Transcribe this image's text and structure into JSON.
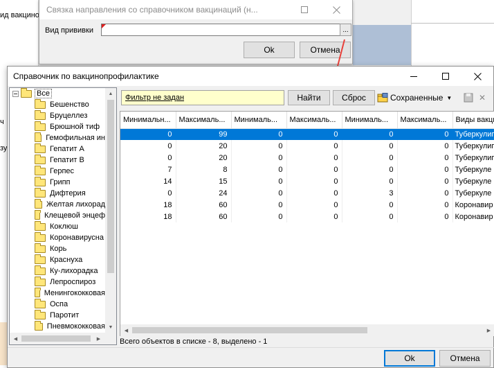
{
  "background": {
    "left_text_1": "ид вакцинопр",
    "left_text_2": "ч",
    "left_text_3": "зу"
  },
  "dialog_link": {
    "title": "Связка направления со справочником вакцинаций (н...",
    "field_label": "Вид прививки",
    "field_value": "",
    "ellipsis_label": "...",
    "ok_label": "Ok",
    "cancel_label": "Отмена"
  },
  "dialog_ref": {
    "title": "Справочник по вакцинопрофилактике",
    "tree": {
      "root": "Все",
      "items": [
        "Бешенство",
        "Бруцеллез",
        "Брюшной тиф",
        "Гемофильная ин",
        "Гепатит А",
        "Гепатит В",
        "Герпес",
        "Грипп",
        "Дифтерия",
        "Желтая лихорад",
        "Клещевой энцеф",
        "Коклюш",
        "Коронавирусна",
        "Корь",
        "Краснуха",
        "Ку-лихорадка",
        "Лепроспироз",
        "Менингококковая",
        "Оспа",
        "Паротит",
        "Пневмококковая"
      ]
    },
    "toolbar": {
      "filter_text": "Фильтр не задан",
      "find_label": "Найти",
      "reset_label": "Сброс",
      "saved_label": "Сохраненные"
    },
    "grid": {
      "columns": [
        "Минимальн...",
        "Максималь...",
        "Минималь...",
        "Максималь...",
        "Минималь...",
        "Максималь...",
        "Виды вакци"
      ],
      "rows": [
        [
          "0",
          "99",
          "0",
          "0",
          "0",
          "0",
          "Туберкулиг"
        ],
        [
          "0",
          "20",
          "0",
          "0",
          "0",
          "0",
          "Туберкулиг"
        ],
        [
          "0",
          "20",
          "0",
          "0",
          "0",
          "0",
          "Туберкулиг"
        ],
        [
          "7",
          "8",
          "0",
          "0",
          "0",
          "0",
          "Туберкуле"
        ],
        [
          "14",
          "15",
          "0",
          "0",
          "0",
          "0",
          "Туберкуле"
        ],
        [
          "0",
          "24",
          "0",
          "0",
          "3",
          "0",
          "Туберкуле"
        ],
        [
          "18",
          "60",
          "0",
          "0",
          "0",
          "0",
          "Коронавир"
        ],
        [
          "18",
          "60",
          "0",
          "0",
          "0",
          "0",
          "Коронавир"
        ]
      ],
      "selected_row": 0
    },
    "status": "Всего объектов в списке - 8, выделено - 1",
    "ok_label": "Ok",
    "cancel_label": "Отмена"
  },
  "colors": {
    "selection": "#0078d7",
    "filter_bg": "#ffffcc",
    "arrow": "#e8403a",
    "required_marker": "#e02020"
  }
}
